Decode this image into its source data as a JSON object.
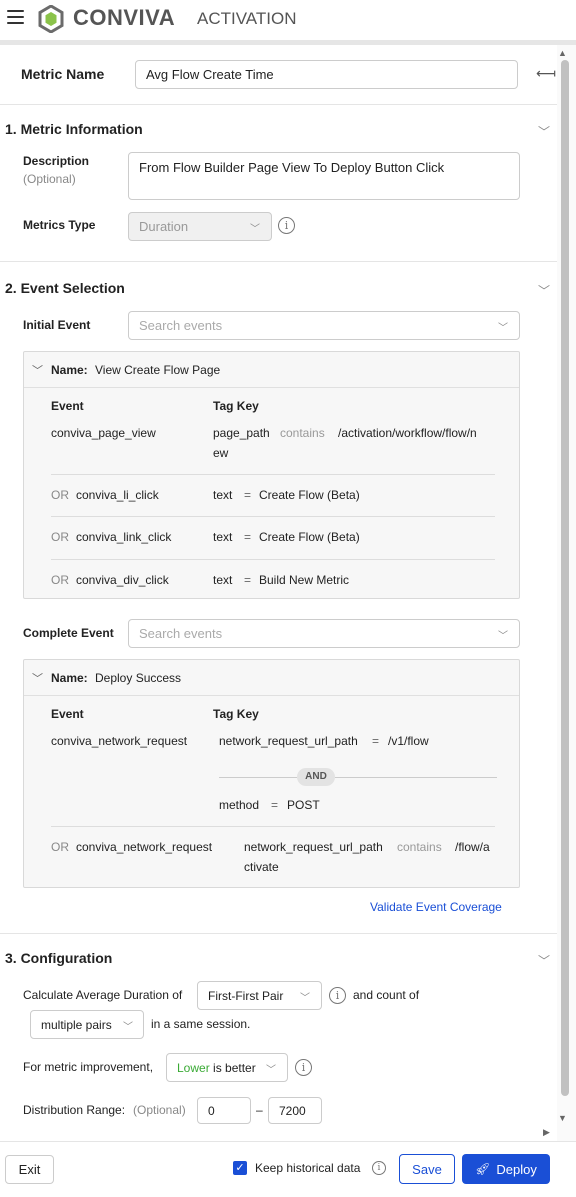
{
  "app": {
    "brand": "CONVIVA",
    "product": "ACTIVATION",
    "logo_icon": "conviva-logo-icon",
    "menu_icon": "hamburger-menu-icon"
  },
  "metric": {
    "name_label": "Metric Name",
    "name_value": "Avg Flow Create Time"
  },
  "section1": {
    "title": "1. Metric Information",
    "description_label": "Description",
    "description_optional": "(Optional)",
    "description_value": "From Flow Builder Page View To Deploy Button Click",
    "metrics_type_label": "Metrics Type",
    "metrics_type_value": "Duration"
  },
  "section2": {
    "title": "2. Event Selection",
    "initial_event_label": "Initial Event",
    "search_placeholder": "Search events",
    "initial_card": {
      "name_label": "Name:",
      "name_value": "View Create Flow Page",
      "col_event": "Event",
      "col_tagkey": "Tag Key",
      "rows": [
        {
          "or": "",
          "event": "conviva_page_view",
          "key": "page_path",
          "op": "contains",
          "value1": "/activation/workflow/flow/n",
          "value2": "ew"
        },
        {
          "or": "OR",
          "event": "conviva_li_click",
          "key": "text",
          "op": "=",
          "value1": "Create Flow (Beta)",
          "value2": ""
        },
        {
          "or": "OR",
          "event": "conviva_link_click",
          "key": "text",
          "op": "=",
          "value1": "Create Flow (Beta)",
          "value2": ""
        },
        {
          "or": "OR",
          "event": "conviva_div_click",
          "key": "text",
          "op": "=",
          "value1": "Build New Metric",
          "value2": ""
        }
      ]
    },
    "complete_event_label": "Complete Event",
    "complete_card": {
      "name_label": "Name:",
      "name_value": "Deploy Success",
      "col_event": "Event",
      "col_tagkey": "Tag Key",
      "row1_event": "conviva_network_request",
      "row1_key": "network_request_url_path",
      "row1_op": "=",
      "row1_value": "/v1/flow",
      "and_label": "AND",
      "row1b_key": "method",
      "row1b_op": "=",
      "row1b_value": "POST",
      "row2_or": "OR",
      "row2_event": "conviva_network_request",
      "row2_key": "network_request_url_path",
      "row2_op": "contains",
      "row2_value1": "/flow/a",
      "row2_value2": "ctivate"
    },
    "validate_link": "Validate Event Coverage"
  },
  "section3": {
    "title": "3. Configuration",
    "calc_prefix": "Calculate Average Duration of",
    "pair_mode": "First-First Pair",
    "calc_mid": "and count of",
    "count_mode": "multiple pairs",
    "calc_suffix": "in a same session.",
    "improvement_label": "For metric improvement,",
    "improvement_highlight": "Lower",
    "improvement_rest": " is better",
    "range_label": "Distribution Range:",
    "range_optional": "(Optional)",
    "range_min": "0",
    "range_sep": "–",
    "range_max": "7200"
  },
  "footer": {
    "exit": "Exit",
    "keep_historical": "Keep historical data",
    "keep_checked": true,
    "save": "Save",
    "deploy": "Deploy"
  },
  "colors": {
    "primary": "#1a4fd6",
    "green": "#3aaa35"
  }
}
